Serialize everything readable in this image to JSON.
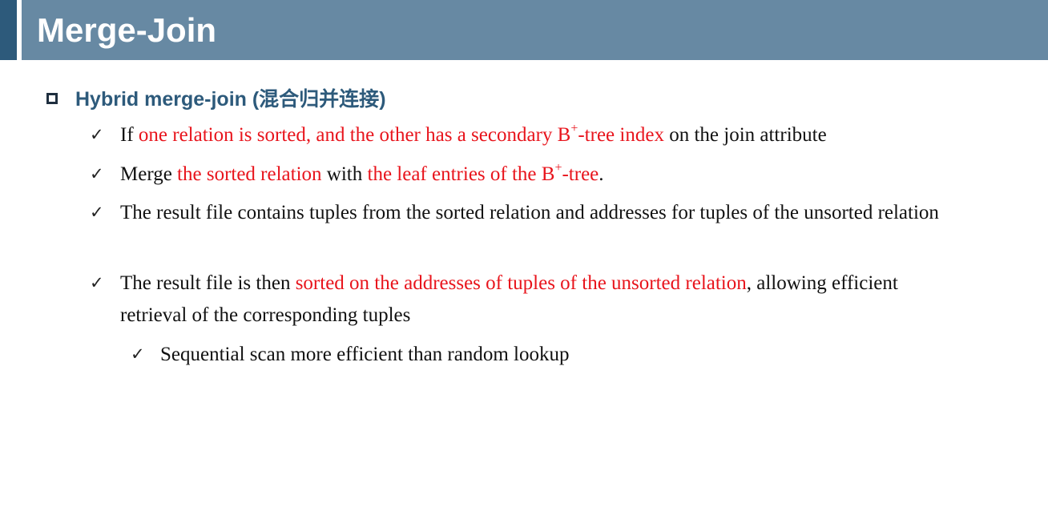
{
  "slide": {
    "title": "Merge-Join",
    "level1": {
      "label": "Hybrid merge-join (混合归并连接)",
      "bullet_icon": "hollow-square-icon"
    },
    "bullet_icon": "check-mark-icon",
    "bullets": [
      {
        "parts": {
          "a": "If ",
          "b": "one relation is sorted, and the other has a secondary B",
          "c": "+",
          "d": "-tree index",
          "e": " on the join attribute"
        }
      },
      {
        "parts": {
          "a": "Merge ",
          "b": "the sorted relation",
          "c": " with ",
          "d": "the leaf entries of the B",
          "e": "+",
          "f": "-tree",
          "g": "."
        }
      },
      {
        "text": "The result file contains tuples from the sorted relation and addresses for tuples of the unsorted relation"
      },
      {
        "parts": {
          "a": "The result file is then ",
          "b": "sorted on the addresses of tuples of the unsorted relation",
          "c": ", allowing efficient retrieval of the corresponding tuples"
        }
      }
    ],
    "sub_bullets": [
      {
        "text": "Sequential scan more efficient than random lookup"
      }
    ],
    "colors": {
      "title_bar": "#6789a3",
      "title_accent": "#2d5a7b",
      "heading": "#2d5a7b",
      "highlight": "#e8141c",
      "body_text": "#111111"
    }
  }
}
